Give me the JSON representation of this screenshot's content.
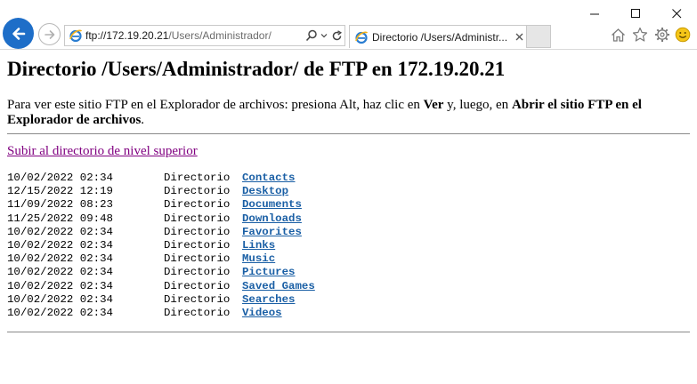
{
  "browser": {
    "address_host": "ftp://172.19.20.21",
    "address_path": "/Users/Administrador/",
    "tab_title": "Directorio /Users/Administr...",
    "icons": {
      "back": "back-arrow-icon",
      "forward": "forward-arrow-icon",
      "search": "search-icon",
      "refresh": "refresh-icon",
      "home": "home-icon",
      "favorites": "star-icon",
      "tools": "gear-icon",
      "feedback": "smiley-icon"
    },
    "colors": {
      "back_button": "#1e6ec8",
      "smiley": "#f5c518"
    }
  },
  "page": {
    "heading": "Directorio /Users/Administrador/ de FTP en 172.19.20.21",
    "intro_prefix": "Para ver este sitio FTP en el Explorador de archivos: presiona Alt, haz clic en ",
    "intro_ver": "Ver",
    "intro_middle": " y, luego, en ",
    "intro_open": "Abrir el sitio FTP en el Explorador de archivos",
    "intro_end": ".",
    "up_link": "Subir al directorio de nivel superior",
    "entries": [
      {
        "date": "10/02/2022 02:34",
        "type": "Directorio",
        "name": "Contacts"
      },
      {
        "date": "12/15/2022 12:19",
        "type": "Directorio",
        "name": "Desktop"
      },
      {
        "date": "11/09/2022 08:23",
        "type": "Directorio",
        "name": "Documents"
      },
      {
        "date": "11/25/2022 09:48",
        "type": "Directorio",
        "name": "Downloads"
      },
      {
        "date": "10/02/2022 02:34",
        "type": "Directorio",
        "name": "Favorites"
      },
      {
        "date": "10/02/2022 02:34",
        "type": "Directorio",
        "name": "Links"
      },
      {
        "date": "10/02/2022 02:34",
        "type": "Directorio",
        "name": "Music"
      },
      {
        "date": "10/02/2022 02:34",
        "type": "Directorio",
        "name": "Pictures"
      },
      {
        "date": "10/02/2022 02:34",
        "type": "Directorio",
        "name": "Saved Games"
      },
      {
        "date": "10/02/2022 02:34",
        "type": "Directorio",
        "name": "Searches"
      },
      {
        "date": "10/02/2022 02:34",
        "type": "Directorio",
        "name": "Videos"
      }
    ],
    "colors": {
      "visited_link": "#800080",
      "dir_link": "#1a5fa5"
    }
  }
}
